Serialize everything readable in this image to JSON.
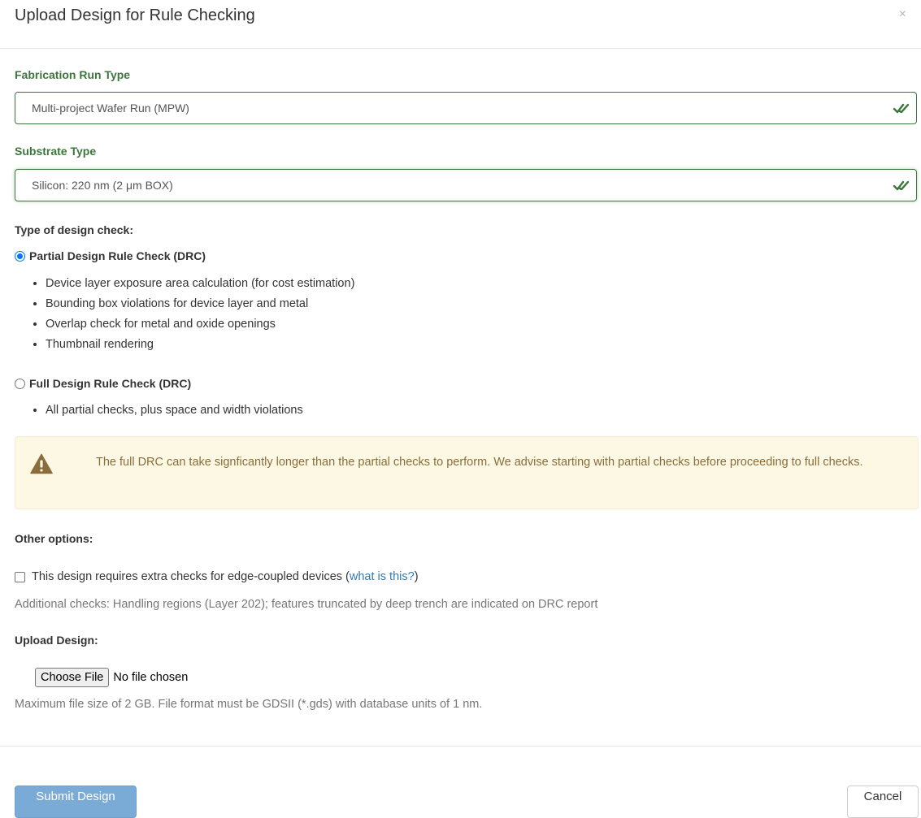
{
  "modal": {
    "title": "Upload Design for Rule Checking",
    "close_glyph": "×"
  },
  "fabrication": {
    "label": "Fabrication Run Type",
    "value": "Multi-project Wafer Run (MPW)"
  },
  "substrate": {
    "label": "Substrate Type",
    "value": "Silicon: 220 nm (2 μm BOX)"
  },
  "design_check": {
    "label": "Type of design check:",
    "options": [
      {
        "label": "Partial Design Rule Check (DRC)",
        "selected": true,
        "bullets": [
          "Device layer exposure area calculation (for cost estimation)",
          "Bounding box violations for device layer and metal",
          "Overlap check for metal and oxide openings",
          "Thumbnail rendering"
        ]
      },
      {
        "label": "Full Design Rule Check (DRC)",
        "selected": false,
        "bullets": [
          "All partial checks, plus space and width violations"
        ]
      }
    ]
  },
  "warning": {
    "icon": "warning-triangle-icon",
    "text": "The full DRC can take signficantly longer than the partial checks to perform. We advise starting with partial checks before proceeding to full checks."
  },
  "other_options": {
    "label": "Other options:",
    "edge_coupled": {
      "checked": false,
      "label": "This design requires extra checks for edge-coupled devices",
      "paren_open": "(",
      "link_text": "what is this?",
      "paren_close": ")"
    },
    "help_text": "Additional checks: Handling regions (Layer 202); features truncated by deep trench are indicated on DRC report"
  },
  "upload": {
    "label": "Upload Design:",
    "button_label": "Choose File",
    "status": "No file chosen",
    "help_text": "Maximum file size of 2 GB. File format must be GDSII (*.gds) with database units of 1 nm."
  },
  "footer": {
    "submit_label": "Submit Design",
    "cancel_label": "Cancel"
  },
  "colors": {
    "success_green": "#3c763d",
    "warning_bg": "#fcf8e3",
    "warning_text": "#8a6d3b",
    "primary_disabled": "#7aaad6",
    "link": "#337ab7"
  }
}
